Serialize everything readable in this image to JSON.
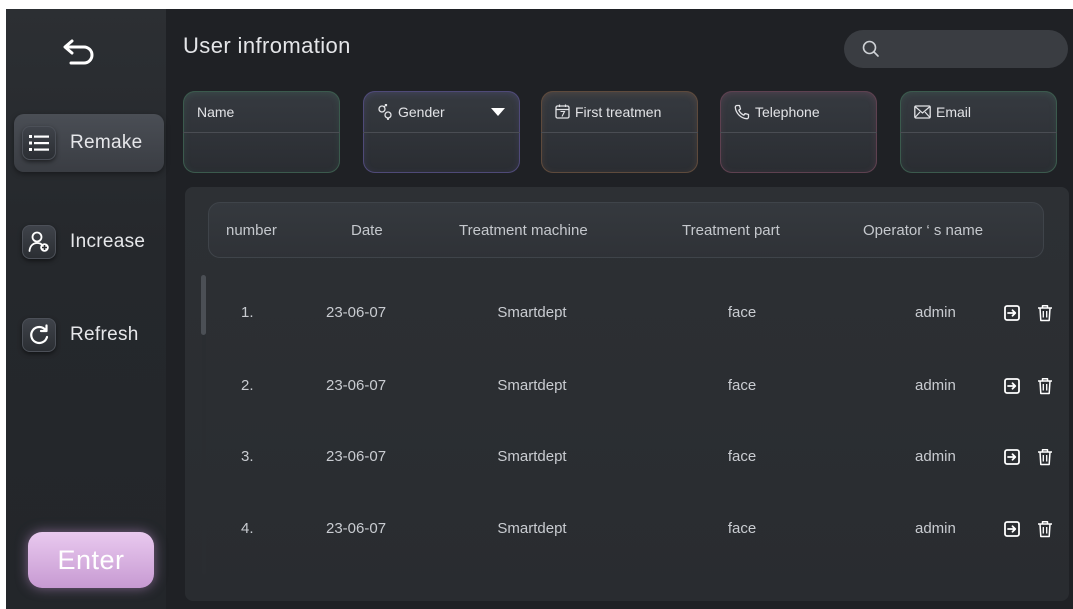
{
  "sidebar": {
    "items": [
      {
        "label": "Remake",
        "icon": "list-icon",
        "active": true
      },
      {
        "label": "Increase",
        "icon": "add-user-icon",
        "active": false
      },
      {
        "label": "Refresh",
        "icon": "refresh-icon",
        "active": false
      }
    ],
    "enter_label": "Enter"
  },
  "header": {
    "title": "User infromation",
    "search_placeholder": ""
  },
  "filters": {
    "name": {
      "label": "Name",
      "value": ""
    },
    "gender": {
      "label": "Gender",
      "value": ""
    },
    "first_treatment": {
      "label": "First treatmen",
      "value": ""
    },
    "telephone": {
      "label": "Telephone",
      "value": ""
    },
    "email": {
      "label": "Email",
      "value": ""
    }
  },
  "table": {
    "columns": [
      "number",
      "Date",
      "Treatment machine",
      "Treatment part",
      "Operator ‘ s name"
    ],
    "rows": [
      {
        "number": "1.",
        "date": "23-06-07",
        "machine": "Smartdept",
        "part": "face",
        "operator": "admin"
      },
      {
        "number": "2.",
        "date": "23-06-07",
        "machine": "Smartdept",
        "part": "face",
        "operator": "admin"
      },
      {
        "number": "3.",
        "date": "23-06-07",
        "machine": "Smartdept",
        "part": "face",
        "operator": "admin"
      },
      {
        "number": "4.",
        "date": "23-06-07",
        "machine": "Smartdept",
        "part": "face",
        "operator": "admin"
      }
    ]
  },
  "colors": {
    "accent_enter": "#d9b0e2",
    "background": "#1f2125",
    "panel": "#2b2e32",
    "icon_light": "#e6e7ea"
  }
}
